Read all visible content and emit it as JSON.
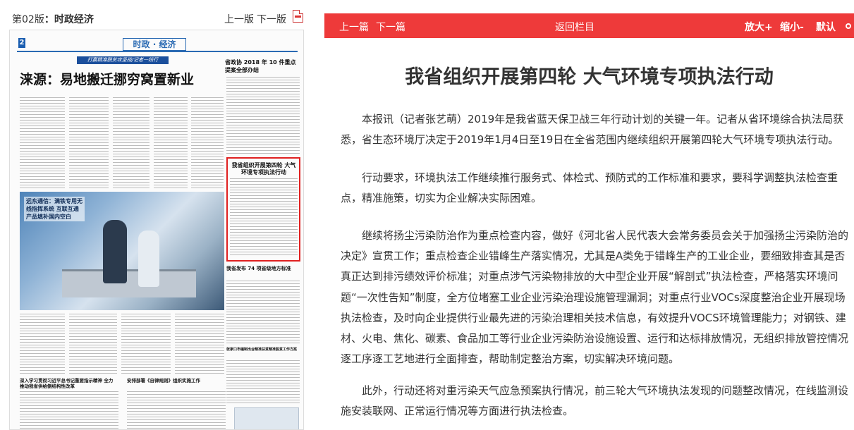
{
  "edition": {
    "page_label": "第02版",
    "separator": "：",
    "section_name": "时政经济",
    "prev_label": "上一版",
    "next_label": "下一版",
    "pdf_icon": "pdf-icon"
  },
  "thumbnail": {
    "page_number": "2",
    "section_tag": "时政 · 经济",
    "banner": "打赢精准脱贫攻坚战/记者一线行",
    "headline": "涞源：易地搬迁挪穷窝置新业",
    "right_head_1": "省政协 2018 年 10 件重点提案全部办结",
    "photo_caption": "远东通信：满铁专用无线指挥系统 互联互通产品填补国内空白",
    "highlight_title": "我省组织开展第四轮 大气环境专项执法行动",
    "right_head_2": "我省发布 74 项省级地方标准",
    "right_head_3": "张家口市编制出台精准扶贫精准脱贫工作方案",
    "bottom_head_1": "深入学习贯彻习近平总书记重要指示精神 全力推动我省供给侧结构性改革",
    "bottom_head_2": "安排部署《自律规则》组织实施工作"
  },
  "toolbar": {
    "prev_article": "上一篇",
    "next_article": "下一篇",
    "back": "返回栏目",
    "zoom_in": "放大+",
    "zoom_out": "缩小-",
    "default": "默认",
    "default_icon": "circle-icon",
    "bar_color": "#ee3a3a"
  },
  "article": {
    "title": "我省组织开展第四轮 大气环境专项执法行动",
    "paragraphs": [
      "本报讯（记者张艺萌）2019年是我省蓝天保卫战三年行动计划的关键一年。记者从省环境综合执法局获悉，省生态环境厅决定于2019年1月4日至19日在全省范围内继续组织开展第四轮大气环境专项执法行动。",
      "行动要求，环境执法工作继续推行服务式、体检式、预防式的工作标准和要求，要科学调整执法检查重点，精准施策，切实为企业解决实际困难。",
      "继续将扬尘污染防治作为重点检查内容，做好《河北省人民代表大会常务委员会关于加强扬尘污染防治的决定》宣贯工作；重点检查企业错峰生产落实情况，尤其是A类免于错峰生产的工业企业，要细致排查其是否真正达到排污绩效评价标准；对重点涉气污染物排放的大中型企业开展“解剖式”执法检查，严格落实环境问题“一次性告知”制度，全方位堵塞工业企业污染治理设施管理漏洞；对重点行业VOCs深度整治企业开展现场执法检查，及时向企业提供行业最先进的污染治理相关技术信息，有效提升VOCS环境管理能力；对钢铁、建材、火电、焦化、碳素、食品加工等行业企业污染防治设施设置、运行和达标排放情况，无组织排放管控情况逐工序逐工艺地进行全面排查，帮助制定整治方案，切实解决环境问题。",
      "此外，行动还将对重污染天气应急预案执行情况，前三轮大气环境执法发现的问题整改情况，在线监测设施安装联网、正常运行情况等方面进行执法检查。"
    ]
  }
}
